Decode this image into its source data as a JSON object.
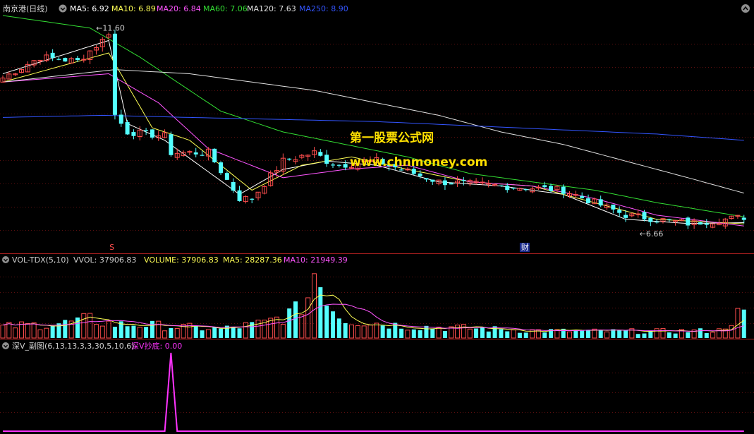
{
  "colors": {
    "background": "#000000",
    "up": "#ff4d4d",
    "down": "#54ffff",
    "ma5": "#ffffff",
    "ma10": "#ffff55",
    "ma20": "#ff55ff",
    "ma60": "#33dd33",
    "ma120": "#e0e0e0",
    "ma250": "#3355ff",
    "panel_border": "#b02020",
    "indicator": "#ff33ff",
    "watermark": "#ffe000"
  },
  "main_legend": {
    "title": "南京港(日线)",
    "ma5": "MA5: 6.92",
    "ma10": "MA10: 6.89",
    "ma20": "MA20: 6.84",
    "ma60": "MA60: 7.06",
    "ma120": "MA120: 7.63",
    "ma250": "MA250: 8.90"
  },
  "annotations": {
    "high": "←11.60",
    "low": "←6.66",
    "marker_s": "S",
    "marker_cai": "财"
  },
  "watermark": {
    "line1": "第一股票公式网",
    "line2": "www.chnmoney.com"
  },
  "volume_legend": {
    "title": "VOL-TDX(5,10)",
    "vvol": "VVOL: 37906.83",
    "volume": "VOLUME: 37906.83",
    "ma5": "MA5: 28287.36",
    "ma10": "MA10: 21949.39"
  },
  "indicator_legend": {
    "title": "深V_副图(6,13,13,3,3,30,5,10,6)",
    "signal": "深V抄底: 0.00"
  },
  "chart_data": [
    {
      "type": "candlestick",
      "title": "南京港(日线)",
      "n": 120,
      "price_range": [
        6.3,
        11.9
      ],
      "high_point": 11.6,
      "low_point": 6.66,
      "close_anchor_index": [
        0,
        6,
        12,
        16,
        17,
        18,
        20,
        26,
        27,
        33,
        38,
        40,
        45,
        50,
        52,
        54,
        60,
        70,
        80,
        90,
        100,
        110,
        119
      ],
      "close_anchor_value": [
        10.4,
        10.9,
        10.8,
        11.3,
        11.5,
        9.5,
        9.1,
        9.0,
        8.6,
        8.6,
        7.5,
        7.5,
        8.4,
        8.6,
        8.4,
        8.3,
        8.4,
        7.9,
        7.8,
        7.7,
        7.1,
        6.9,
        7.05
      ],
      "ma_series": [
        {
          "name": "MA5",
          "index": [
            0,
            17,
            20,
            26,
            38,
            45,
            52,
            60,
            70,
            80,
            90,
            100,
            110,
            119
          ],
          "values": [
            10.5,
            11.3,
            9.3,
            8.9,
            7.6,
            8.2,
            8.4,
            8.3,
            7.9,
            7.8,
            7.6,
            7.0,
            6.9,
            6.92
          ]
        },
        {
          "name": "MA10",
          "index": [
            0,
            17,
            24,
            30,
            40,
            48,
            56,
            65,
            75,
            85,
            95,
            105,
            119
          ],
          "values": [
            10.3,
            11.0,
            9.2,
            8.9,
            7.7,
            8.3,
            8.5,
            8.2,
            7.9,
            7.8,
            7.4,
            7.0,
            6.89
          ]
        },
        {
          "name": "MA20",
          "index": [
            0,
            17,
            25,
            33,
            45,
            55,
            65,
            75,
            85,
            95,
            105,
            119
          ],
          "values": [
            10.3,
            10.5,
            9.8,
            8.7,
            8.0,
            8.2,
            8.3,
            7.9,
            7.8,
            7.5,
            7.1,
            6.84
          ]
        },
        {
          "name": "MA60",
          "index": [
            0,
            14,
            22,
            35,
            45,
            55,
            65,
            75,
            85,
            95,
            105,
            119
          ],
          "values": [
            11.9,
            11.6,
            10.9,
            9.6,
            9.1,
            8.8,
            8.5,
            8.1,
            7.9,
            7.7,
            7.4,
            7.06
          ]
        },
        {
          "name": "MA120",
          "index": [
            0,
            18,
            30,
            40,
            50,
            60,
            70,
            80,
            90,
            100,
            110,
            119
          ],
          "values": [
            10.3,
            10.6,
            10.5,
            10.3,
            10.1,
            9.8,
            9.5,
            9.1,
            8.8,
            8.4,
            8.0,
            7.63
          ]
        },
        {
          "name": "MA250",
          "index": [
            0,
            16,
            30,
            45,
            60,
            75,
            90,
            105,
            119
          ],
          "values": [
            9.45,
            9.5,
            9.45,
            9.4,
            9.35,
            9.25,
            9.15,
            9.05,
            8.9
          ]
        }
      ]
    },
    {
      "type": "bar",
      "title": "VOL-TDX(5,10)",
      "volume_range": [
        0,
        95000
      ],
      "vol_anchor_index": [
        0,
        10,
        14,
        18,
        22,
        28,
        35,
        42,
        47,
        49,
        50,
        52,
        53,
        55,
        60,
        65,
        75,
        85,
        95,
        105,
        115,
        119
      ],
      "vol_anchor_value": [
        15000,
        20000,
        25000,
        18000,
        18000,
        15000,
        12000,
        20000,
        35000,
        55000,
        90000,
        60000,
        40000,
        25000,
        20000,
        16000,
        13000,
        10000,
        9000,
        9000,
        10000,
        37906.83
      ],
      "last_volume": 37906.83,
      "ma5_last": 28287.36,
      "ma10_last": 21949.39
    },
    {
      "type": "line",
      "title": "深V_副图(6,13,13,3,3,30,5,10,6)",
      "series_name": "深V抄底",
      "ylim": [
        0,
        1
      ],
      "spike_index": 27,
      "spike_value": 1.0,
      "last_value": 0.0
    }
  ]
}
